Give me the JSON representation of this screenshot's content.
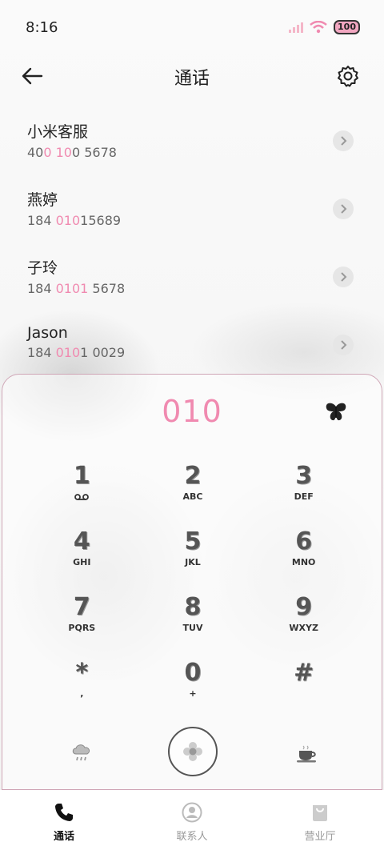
{
  "status": {
    "time": "8:16",
    "battery": "100"
  },
  "header": {
    "title": "通话"
  },
  "contacts": [
    {
      "name": "小米客服",
      "number_pre": "40",
      "number_hl": "0 10",
      "number_post": "0 5678"
    },
    {
      "name": "燕婷",
      "number_pre": "184 ",
      "number_hl": "010",
      "number_post": "15689"
    },
    {
      "name": "子玲",
      "number_pre": "184 ",
      "number_hl": "0101",
      "number_post": " 5678"
    },
    {
      "name": "Jason",
      "number_pre": "184 ",
      "number_hl": "010",
      "number_post": "1 0029"
    }
  ],
  "dialer": {
    "input_value": "010",
    "keys": [
      {
        "digit": "1",
        "letters": "oo"
      },
      {
        "digit": "2",
        "letters": "ABC"
      },
      {
        "digit": "3",
        "letters": "DEF"
      },
      {
        "digit": "4",
        "letters": "GHI"
      },
      {
        "digit": "5",
        "letters": "JKL"
      },
      {
        "digit": "6",
        "letters": "MNO"
      },
      {
        "digit": "7",
        "letters": "PQRS"
      },
      {
        "digit": "8",
        "letters": "TUV"
      },
      {
        "digit": "9",
        "letters": "WXYZ"
      },
      {
        "digit": "*",
        "letters": ","
      },
      {
        "digit": "0",
        "letters": "+"
      },
      {
        "digit": "#",
        "letters": ""
      }
    ]
  },
  "nav": {
    "items": [
      {
        "label": "通话",
        "icon": "phone-icon",
        "active": true
      },
      {
        "label": "联系人",
        "icon": "person-icon",
        "active": false
      },
      {
        "label": "营业厅",
        "icon": "shopping-bag-icon",
        "active": false
      }
    ]
  },
  "colors": {
    "accent": "#f08ab0"
  }
}
